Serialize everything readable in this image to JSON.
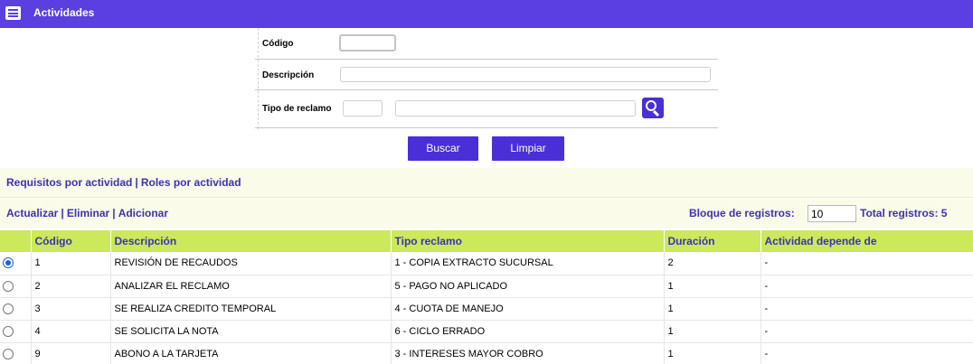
{
  "header": {
    "title": "Actividades",
    "icon": "form-icon"
  },
  "filters": {
    "codigo_label": "Código",
    "codigo_value": "",
    "descripcion_label": "Descripción",
    "descripcion_value": "",
    "tipo_label": "Tipo de reclamo",
    "tipo_code_value": "",
    "tipo_desc_value": ""
  },
  "buttons": {
    "buscar": "Buscar",
    "limpiar": "Limpiar"
  },
  "links_top": {
    "requisitos": "Requisitos por actividad",
    "sep": "|",
    "roles": "Roles por actividad"
  },
  "actions": {
    "actualizar": "Actualizar",
    "sep": "|",
    "eliminar": "Eliminar",
    "adicionar": "Adicionar"
  },
  "bloque": {
    "label": "Bloque de registros:",
    "value": "10"
  },
  "total": {
    "label": "Total registros: 5"
  },
  "table": {
    "headers": [
      "Código",
      "Descripción",
      "Tipo reclamo",
      "Duración",
      "Actividad depende de"
    ],
    "rows": [
      {
        "selected": true,
        "codigo": "1",
        "descripcion": "REVISIÓN DE RECAUDOS",
        "tipo": "1 - COPIA EXTRACTO SUCURSAL",
        "duracion": "2",
        "depende": "-"
      },
      {
        "selected": false,
        "codigo": "2",
        "descripcion": "ANALIZAR EL RECLAMO",
        "tipo": "5 - PAGO NO APLICADO",
        "duracion": "1",
        "depende": "-"
      },
      {
        "selected": false,
        "codigo": "3",
        "descripcion": "SE REALIZA CREDITO TEMPORAL",
        "tipo": "4 - CUOTA DE MANEJO",
        "duracion": "1",
        "depende": "-"
      },
      {
        "selected": false,
        "codigo": "4",
        "descripcion": "SE SOLICITA LA NOTA",
        "tipo": "6 - CICLO ERRADO",
        "duracion": "1",
        "depende": "-"
      },
      {
        "selected": false,
        "codigo": "9",
        "descripcion": "ABONO A LA TARJETA",
        "tipo": "3 - INTERESES MAYOR COBRO",
        "duracion": "1",
        "depende": "-"
      }
    ]
  },
  "colors": {
    "header_bg": "#5b3fe0",
    "button_bg": "#4a2fd6",
    "table_header_bg": "#cbe95a",
    "link": "#3d32b8",
    "panel_bg": "#fafbe9"
  }
}
